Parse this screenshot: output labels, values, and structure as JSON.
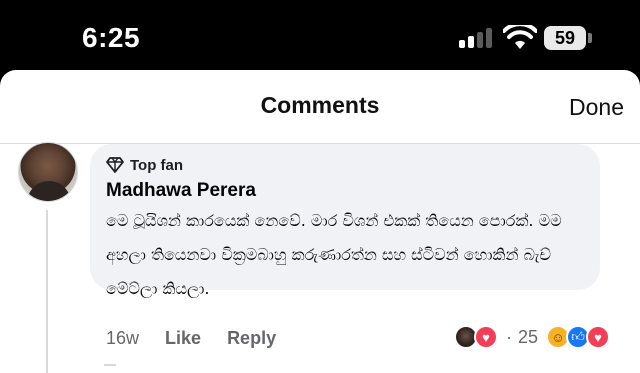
{
  "status_bar": {
    "time": "6:25",
    "battery": "59",
    "icons": [
      "signal-icon",
      "wifi-icon",
      "battery-icon"
    ]
  },
  "sheet": {
    "title": "Comments",
    "done_label": "Done"
  },
  "comment": {
    "badge_icon": "diamond-icon",
    "badge_label": "Top fan",
    "author": "Madhawa Perera",
    "text": "මෙ ටූයිශන් කාරයෙක් නෙවේ. මාර විශන් එකක් තියෙන පොරක්. මම අහලා තියෙනවා වික්‍රමබාහු කරුණාරත්න සහ ස්ටිවන් හොකින් බැච් මේට්ලා කියලා.",
    "timestamp": "16w",
    "like_label": "Like",
    "reply_label": "Reply",
    "reaction_separator": "·",
    "reaction_count": "25",
    "reactions": [
      "love",
      "haha",
      "like",
      "love"
    ]
  },
  "colors": {
    "love": "#f33e58",
    "haha": "#f7b125",
    "like": "#1877f2",
    "bubble": "#f0f2f5"
  }
}
